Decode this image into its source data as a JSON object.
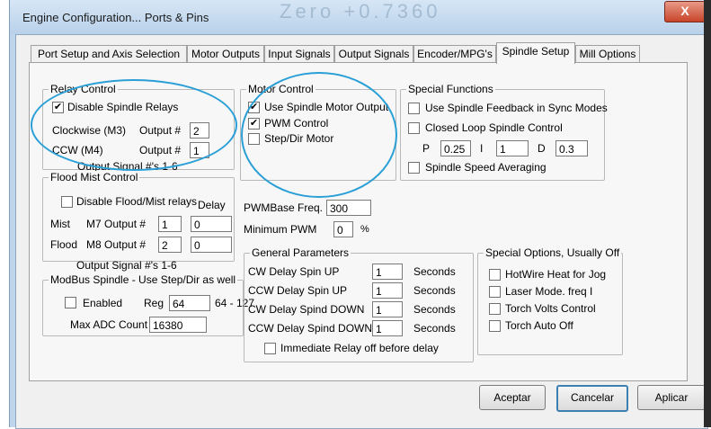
{
  "window": {
    "title": "Engine Configuration... Ports & Pins",
    "background_title_text": "Zero   +0.7360",
    "close_label": "X"
  },
  "tabs": [
    {
      "label": "Port Setup and Axis Selection",
      "active": false
    },
    {
      "label": "Motor Outputs",
      "active": false
    },
    {
      "label": "Input Signals",
      "active": false
    },
    {
      "label": "Output Signals",
      "active": false
    },
    {
      "label": "Encoder/MPG's",
      "active": false
    },
    {
      "label": "Spindle Setup",
      "active": true
    },
    {
      "label": "Mill Options",
      "active": false
    }
  ],
  "relay_control": {
    "title": "Relay Control",
    "disable_spindle_relays": {
      "label": "Disable Spindle Relays",
      "checked": true
    },
    "clockwise": {
      "label": "Clockwise (M3)",
      "output_label": "Output #",
      "value": "2"
    },
    "ccw": {
      "label": "CCW (M4)",
      "output_label": "Output #",
      "value": "1"
    },
    "footer": "Output Signal #'s 1-6"
  },
  "flood_mist": {
    "title": "Flood Mist Control",
    "disable": {
      "label": "Disable Flood/Mist relays",
      "checked": false
    },
    "delay_label": "Delay",
    "mist": {
      "label": "Mist",
      "output_label": "M7 Output #",
      "output": "1",
      "delay": "0"
    },
    "flood": {
      "label": "Flood",
      "output_label": "M8 Output #",
      "output": "2",
      "delay": "0"
    },
    "footer": "Output Signal #'s 1-6"
  },
  "modbus": {
    "title": "ModBus Spindle - Use Step/Dir as well",
    "enabled": {
      "label": "Enabled",
      "checked": false
    },
    "reg_label": "Reg",
    "reg_value": "64",
    "reg_range": "64 - 127",
    "max_adc_label": "Max ADC Count",
    "max_adc_value": "16380"
  },
  "motor_control": {
    "title": "Motor Control",
    "use_spindle_motor_output": {
      "label": "Use Spindle Motor Output",
      "checked": true
    },
    "pwm_control": {
      "label": "PWM Control",
      "checked": true
    },
    "step_dir_motor": {
      "label": "Step/Dir Motor",
      "checked": false
    },
    "pwm_base_freq_label": "PWMBase Freq.",
    "pwm_base_freq_value": "300",
    "minimum_pwm_label": "Minimum PWM",
    "minimum_pwm_value": "0",
    "minimum_pwm_unit": "%"
  },
  "special_functions": {
    "title": "Special Functions",
    "feedback_sync": {
      "label": "Use Spindle Feedback in Sync Modes",
      "checked": false
    },
    "closed_loop": {
      "label": "Closed Loop Spindle Control",
      "checked": false
    },
    "p_label": "P",
    "p_value": "0.25",
    "i_label": "I",
    "i_value": "1",
    "d_label": "D",
    "d_value": "0.3",
    "speed_averaging": {
      "label": "Spindle Speed Averaging",
      "checked": false
    }
  },
  "general_parameters": {
    "title": "General Parameters",
    "rows": [
      {
        "label": "CW Delay Spin UP",
        "value": "1",
        "unit": "Seconds"
      },
      {
        "label": "CCW Delay Spin UP",
        "value": "1",
        "unit": "Seconds"
      },
      {
        "label": "CW Delay Spind DOWN",
        "value": "1",
        "unit": "Seconds"
      },
      {
        "label": "CCW Delay Spind DOWN",
        "value": "1",
        "unit": "Seconds"
      }
    ],
    "immediate_relay": {
      "label": "Immediate Relay off before delay",
      "checked": false
    }
  },
  "special_options": {
    "title": "Special Options, Usually Off",
    "items": [
      {
        "label": "HotWire Heat for Jog",
        "checked": false
      },
      {
        "label": "Laser Mode. freq I",
        "checked": false
      },
      {
        "label": "Torch Volts Control",
        "checked": false
      },
      {
        "label": "Torch Auto Off",
        "checked": false
      }
    ]
  },
  "buttons": {
    "accept": "Aceptar",
    "cancel": "Cancelar",
    "apply": "Aplicar"
  },
  "annotation_color": "#2a9fd6"
}
